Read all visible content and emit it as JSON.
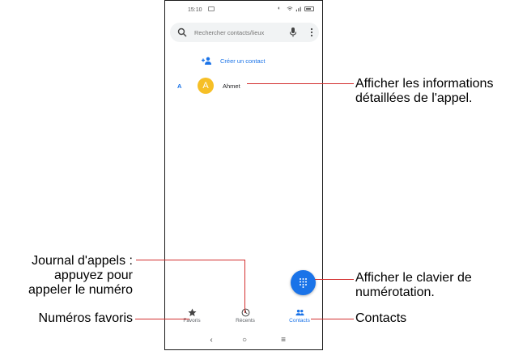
{
  "status": {
    "time": "15:10"
  },
  "search": {
    "placeholder": "Rechercher contacts/lieux"
  },
  "create": {
    "label": "Créer un contact"
  },
  "section": {
    "letter": "A"
  },
  "contact": {
    "initial": "A",
    "name": "Ahmet",
    "avatar_color": "#f6bf26"
  },
  "nav": {
    "favoris": "Favoris",
    "recents": "Récents",
    "contacts": "Contacts",
    "accent": "#1a73e8"
  },
  "annotations": {
    "details_1": "Afficher les informations",
    "details_2": "détaillées de l'appel.",
    "journal_1": "Journal d'appels :",
    "journal_2": "appuyez pour",
    "journal_3": "appeler le numéro",
    "dialpad_1": "Afficher le clavier de",
    "dialpad_2": "numérotation.",
    "favoris": "Numéros favoris",
    "contacts": "Contacts"
  }
}
